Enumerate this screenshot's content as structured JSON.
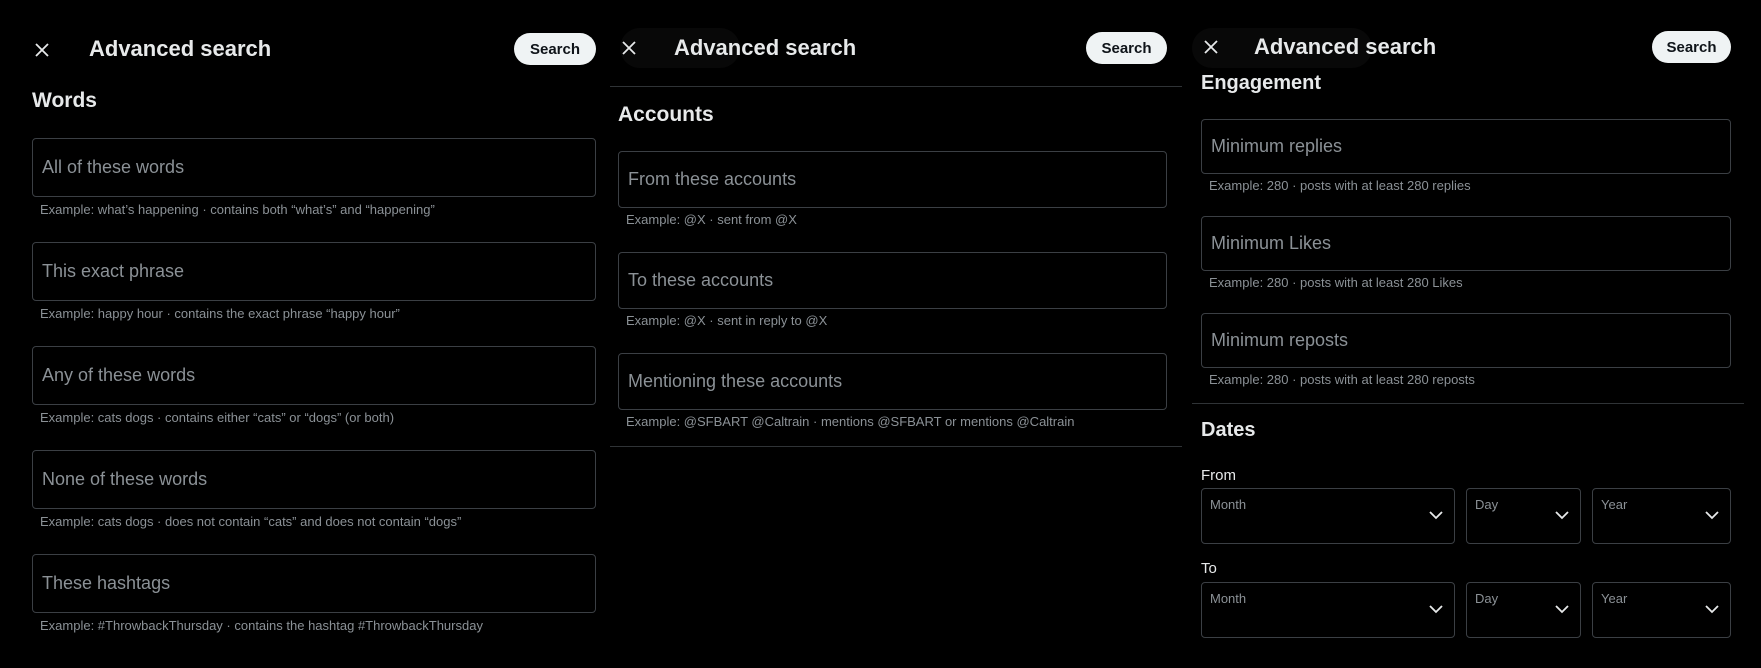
{
  "panels": {
    "words": {
      "title": "Advanced search",
      "search_label": "Search",
      "section": "Words",
      "fields": [
        {
          "placeholder": "All of these words",
          "help": "Example: what’s happening · contains both “what’s” and “happening”"
        },
        {
          "placeholder": "This exact phrase",
          "help": "Example: happy hour · contains the exact phrase “happy hour”"
        },
        {
          "placeholder": "Any of these words",
          "help": "Example: cats dogs · contains either “cats” or “dogs” (or both)"
        },
        {
          "placeholder": "None of these words",
          "help": "Example: cats dogs · does not contain “cats” and does not contain “dogs”"
        },
        {
          "placeholder": "These hashtags",
          "help": "Example: #ThrowbackThursday · contains the hashtag #ThrowbackThursday"
        }
      ]
    },
    "accounts": {
      "title": "Advanced search",
      "search_label": "Search",
      "section": "Accounts",
      "fields": [
        {
          "placeholder": "From these accounts",
          "help": "Example: @X · sent from @X"
        },
        {
          "placeholder": "To these accounts",
          "help": "Example: @X · sent in reply to @X"
        },
        {
          "placeholder": "Mentioning these accounts",
          "help": "Example: @SFBART @Caltrain · mentions @SFBART or mentions @Caltrain"
        }
      ]
    },
    "engagement": {
      "title": "Advanced search",
      "search_label": "Search",
      "section": "Engagement",
      "fields": [
        {
          "placeholder": "Minimum replies",
          "help": "Example: 280 · posts with at least 280 replies"
        },
        {
          "placeholder": "Minimum Likes",
          "help": "Example: 280 · posts with at least 280 Likes"
        },
        {
          "placeholder": "Minimum reposts",
          "help": "Example: 280 · posts with at least 280 reposts"
        }
      ],
      "dates": {
        "section": "Dates",
        "from_label": "From",
        "to_label": "To",
        "month_label": "Month",
        "day_label": "Day",
        "year_label": "Year"
      }
    }
  },
  "icons": {
    "close": "close-icon",
    "chevron": "chevron-down-icon"
  },
  "colors": {
    "background": "#000000",
    "button": "#eff3f4",
    "text": "#e7e9ea",
    "muted": "#8b9196",
    "border": "#3b3f44"
  }
}
